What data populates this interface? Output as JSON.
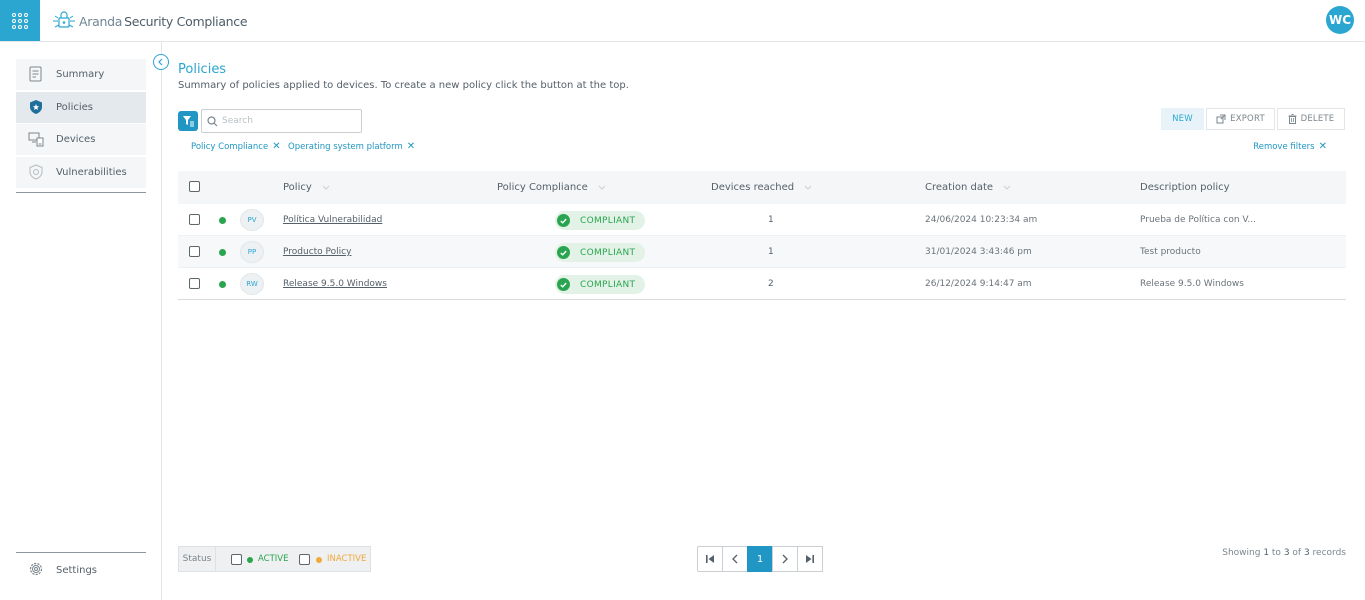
{
  "header": {
    "brand_light": "Aranda",
    "brand_bold": "Security Compliance",
    "user_initials": "WC"
  },
  "sidebar": {
    "items": [
      {
        "label": "Summary",
        "icon": "summary-icon",
        "active": false
      },
      {
        "label": "Policies",
        "icon": "shield-star-icon",
        "active": true
      },
      {
        "label": "Devices",
        "icon": "devices-icon",
        "active": false
      },
      {
        "label": "Vulnerabilities",
        "icon": "vulnerability-shield-icon",
        "active": false
      }
    ],
    "settings_label": "Settings"
  },
  "main": {
    "title": "Policies",
    "subtitle": "Summary of policies applied to devices. To create a new policy click the button at the top.",
    "search_placeholder": "Search",
    "toolbar": {
      "new_label": "NEW",
      "export_label": "EXPORT",
      "delete_label": "DELETE"
    },
    "filters": [
      {
        "label": "Policy Compliance"
      },
      {
        "label": "Operating system platform"
      }
    ],
    "remove_filters_label": "Remove filters",
    "table": {
      "columns": {
        "policy": "Policy",
        "compliance": "Policy Compliance",
        "devices": "Devices reached",
        "created": "Creation date",
        "description": "Description policy"
      },
      "rows": [
        {
          "initials": "PV",
          "name": "Política Vulnerabilidad",
          "compliance": "COMPLIANT",
          "devices": "1",
          "created": "24/06/2024 10:23:34 am",
          "description": "Prueba de Política con V..."
        },
        {
          "initials": "PP",
          "name": "Producto Policy",
          "compliance": "COMPLIANT",
          "devices": "1",
          "created": "31/01/2024 3:43:46 pm",
          "description": "Test producto"
        },
        {
          "initials": "RW",
          "name": "Release 9.5.0 Windows",
          "compliance": "COMPLIANT",
          "devices": "2",
          "created": "26/12/2024 9:14:47 am",
          "description": "Release 9.5.0 Windows"
        }
      ]
    }
  },
  "footer": {
    "status_label": "Status",
    "active_label": "ACTIVE",
    "inactive_label": "INACTIVE",
    "current_page": "1",
    "records_prefix": "Showing ",
    "records_from": "1",
    "records_mid1": " to ",
    "records_to": "3",
    "records_mid2": " of ",
    "records_total": "3",
    "records_suffix": " records"
  },
  "colors": {
    "accent": "#2aa6d1",
    "active_green": "#2aa44f",
    "inactive_orange": "#f0a93b"
  }
}
